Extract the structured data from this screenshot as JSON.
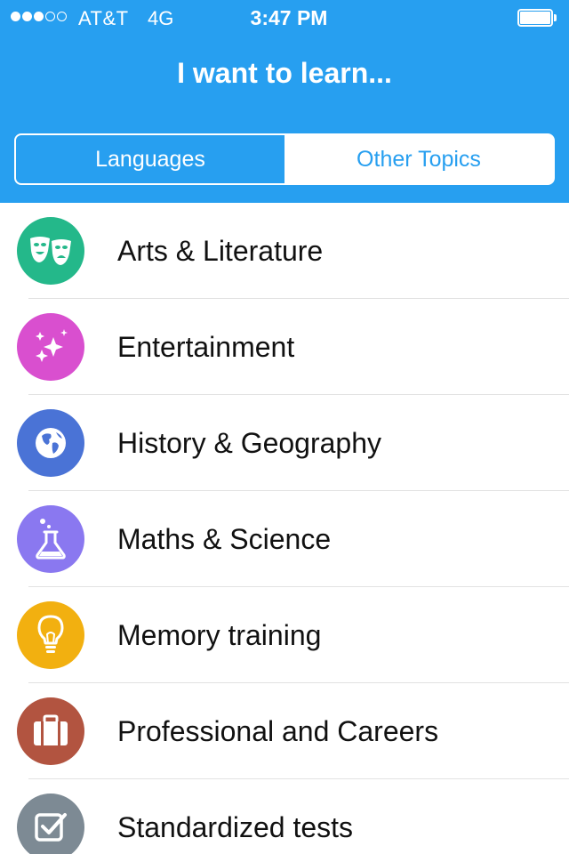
{
  "status_bar": {
    "signal_dots": [
      "full",
      "full",
      "full",
      "empty",
      "empty"
    ],
    "carrier": "AT&T",
    "network": "4G",
    "time": "3:47 PM",
    "battery": "full"
  },
  "header": {
    "title": "I want to learn...",
    "background_color": "#279ff0"
  },
  "segmented_control": {
    "selected": "Languages",
    "segments": [
      {
        "label": "Languages",
        "active": true
      },
      {
        "label": "Other Topics",
        "active": false
      }
    ]
  },
  "topics": [
    {
      "label": "Arts & Literature",
      "icon": "theater-masks-icon",
      "color": "#24b88a"
    },
    {
      "label": "Entertainment",
      "icon": "sparkles-icon",
      "color": "#d94fcf"
    },
    {
      "label": "History & Geography",
      "icon": "globe-icon",
      "color": "#4a73d6"
    },
    {
      "label": "Maths & Science",
      "icon": "flask-icon",
      "color": "#8a78f0"
    },
    {
      "label": "Memory training",
      "icon": "lightbulb-icon",
      "color": "#f2b010"
    },
    {
      "label": "Professional and Careers",
      "icon": "briefcase-icon",
      "color": "#b25440"
    },
    {
      "label": "Standardized tests",
      "icon": "checkbox-icon",
      "color": "#7d8a94"
    }
  ]
}
